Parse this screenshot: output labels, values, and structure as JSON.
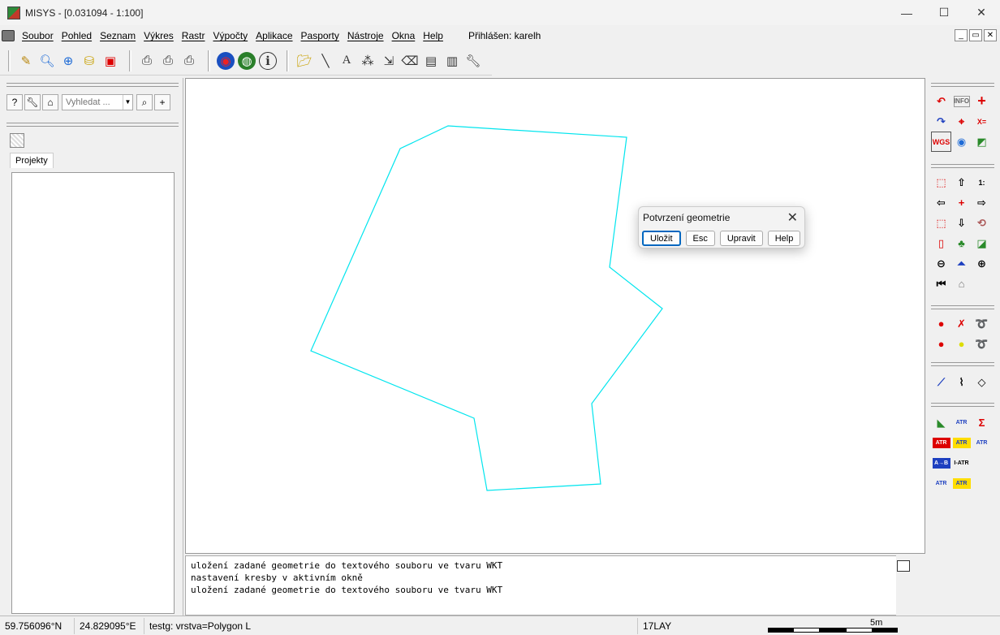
{
  "window": {
    "title": "MISYS - [0.031094 - 1:100]",
    "minimize": "—",
    "maximize": "☐",
    "close": "✕"
  },
  "menu": {
    "items": [
      "Soubor",
      "Pohled",
      "Seznam",
      "Výkres",
      "Rastr",
      "Výpočty",
      "Aplikace",
      "Pasporty",
      "Nástroje",
      "Okna",
      "Help"
    ],
    "login": "Přihlášen: karelh",
    "mdi": [
      "_",
      "▭",
      "✕"
    ]
  },
  "left_panel": {
    "search_placeholder": "Vyhledat ...",
    "help_label": "?",
    "tab_label": "Projekty"
  },
  "dialog": {
    "title": "Potvrzení geometrie",
    "close": "✕",
    "buttons": [
      "Uložit",
      "Esc",
      "Upravit",
      "Help"
    ]
  },
  "log": {
    "lines": [
      "uložení zadané geometrie do textového souboru ve tvaru WKT",
      "nastavení kresby v aktivním okně",
      "uložení zadané geometrie do textového souboru ve tvaru WKT"
    ]
  },
  "status": {
    "lat": "59.756096°N",
    "lon": "24.829095°E",
    "layer": "testg: vrstva=Polygon L",
    "lay_count": "17LAY",
    "scale_label": "5m"
  },
  "colors": {
    "polygon_stroke": "#00e5ee",
    "accent": "#0067c0"
  }
}
